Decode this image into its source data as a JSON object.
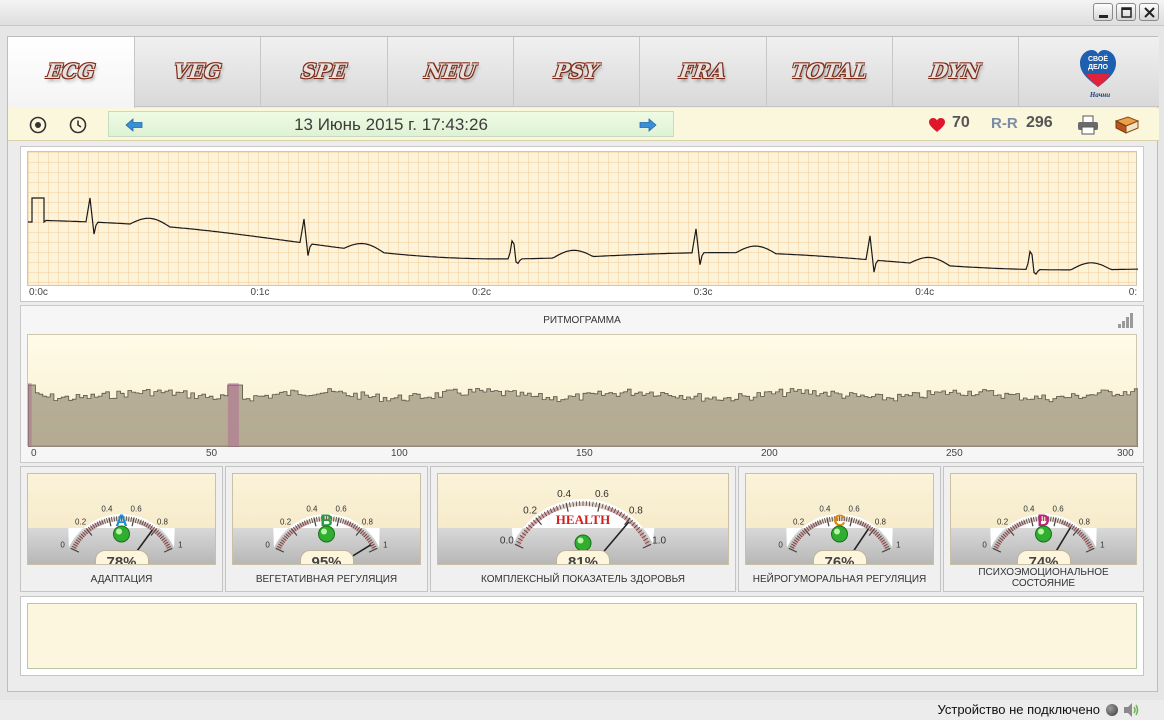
{
  "window": {
    "buttons": [
      "minimize",
      "maximize",
      "close"
    ]
  },
  "tabs": [
    {
      "label": "ECG",
      "active": true
    },
    {
      "label": "VEG",
      "active": false
    },
    {
      "label": "SPE",
      "active": false
    },
    {
      "label": "NEU",
      "active": false
    },
    {
      "label": "PSY",
      "active": false
    },
    {
      "label": "FRA",
      "active": false
    },
    {
      "label": "TOTAL",
      "active": false
    },
    {
      "label": "DYN",
      "active": false
    }
  ],
  "logo": {
    "line1": "СВОЁ",
    "line2": "ДЕЛО",
    "line3": "Начни"
  },
  "toolbar": {
    "date": "13 Июнь 2015 г. 17:43:26",
    "heart_rate": "70",
    "rr_label": "R-R",
    "rr_value": "296"
  },
  "ecg": {
    "x_ticks": [
      "0:0c",
      "0:1c",
      "0:2c",
      "0:3c",
      "0:4c",
      "0:"
    ]
  },
  "rhythmogram": {
    "title": "РИТМОГРАММА",
    "x_ticks": [
      "0",
      "50",
      "100",
      "150",
      "200",
      "250",
      "300"
    ],
    "x_range": [
      0,
      300
    ],
    "highlights": [
      [
        0,
        1
      ],
      [
        54,
        57
      ]
    ]
  },
  "gauges": [
    {
      "letter": "A",
      "letter_color": "#1a8fd0",
      "value": 0.78,
      "percent": "78%",
      "label": "АДАПТАЦИЯ",
      "scale": [
        "0",
        "0.2",
        "0.4",
        "0.6",
        "0.8",
        "1"
      ]
    },
    {
      "letter": "B",
      "letter_color": "#2a9a3a",
      "value": 0.95,
      "percent": "95%",
      "label": "ВЕГЕТАТИВНАЯ РЕГУЛЯЦИЯ",
      "scale": [
        "0",
        "0.2",
        "0.4",
        "0.6",
        "0.8",
        "1"
      ]
    },
    {
      "letter": "HEALTH",
      "letter_color": "#d02020",
      "value": 0.81,
      "percent": "81%",
      "label": "КОМПЛЕКСНЫЙ ПОКАЗАТЕЛЬ ЗДОРОВЬЯ",
      "scale": [
        "0.0",
        "0.2",
        "0.4",
        "0.6",
        "0.8",
        "1.0"
      ]
    },
    {
      "letter": "C",
      "letter_color": "#e08a10",
      "value": 0.76,
      "percent": "76%",
      "label": "НЕЙРОГУМОРАЛЬНАЯ РЕГУЛЯЦИЯ",
      "scale": [
        "0",
        "0.2",
        "0.4",
        "0.6",
        "0.8",
        "1"
      ]
    },
    {
      "letter": "D",
      "letter_color": "#c0207a",
      "value": 0.74,
      "percent": "74%",
      "label_line1": "ПСИХОЭМОЦИОНАЛЬНОЕ",
      "label_line2": "СОСТОЯНИЕ",
      "scale": [
        "0",
        "0.2",
        "0.4",
        "0.6",
        "0.8",
        "1"
      ]
    }
  ],
  "status": {
    "text": "Устройство не подключено"
  }
}
